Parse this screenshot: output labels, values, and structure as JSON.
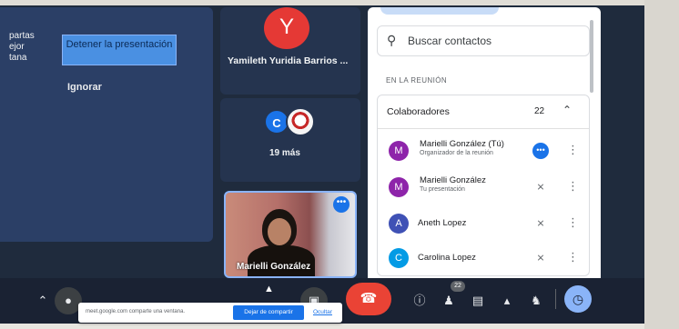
{
  "presentation_popup": {
    "list_items": [
      "partas",
      "ejor",
      "tana"
    ],
    "stop_button": "Detener la presentación",
    "ignore_button": "Ignorar"
  },
  "tiles": {
    "main_participant": {
      "initial": "Y",
      "name": "Yamileth Yuridia Barrios ...",
      "color": "#e53935"
    },
    "more": {
      "initial": "C",
      "label": "19 más"
    },
    "self": {
      "name": "Marielli González",
      "menu_icon": "more-horiz-icon"
    }
  },
  "panel": {
    "search_placeholder": "Buscar contactos",
    "section_title": "EN LA REUNIÓN",
    "collaborators": {
      "label": "Colaboradores",
      "count": "22"
    },
    "participants": [
      {
        "initial": "M",
        "name": "Marielli González (Tú)",
        "subtitle": "Organizador de la reunión",
        "color": "#8e24aa",
        "action_icon": "more-options-icon"
      },
      {
        "initial": "M",
        "name": "Marielli González",
        "subtitle": "Tu presentación",
        "color": "#8e24aa",
        "action_icon": "mic-off-icon"
      },
      {
        "initial": "A",
        "name": "Aneth Lopez",
        "subtitle": "",
        "color": "#3f51b5",
        "action_icon": "mic-off-icon"
      },
      {
        "initial": "C",
        "name": "Carolina Lopez",
        "subtitle": "",
        "color": "#039be5",
        "action_icon": "mic-off-icon"
      }
    ]
  },
  "bottom_bar": {
    "people_badge": "22",
    "share_banner": {
      "text": "meet.google.com comparte una ventana.",
      "stop_button": "Dejar de compartir",
      "hide_link": "Ocultar"
    }
  }
}
